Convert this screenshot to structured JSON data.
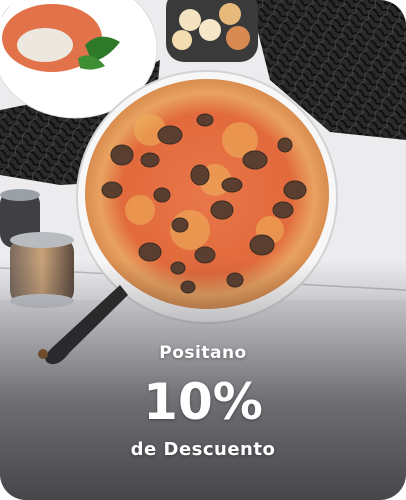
{
  "promo": {
    "restaurant": "Positano",
    "discount": "10%",
    "subtitle": "de Descuento",
    "image_icon": "pizza-photo"
  },
  "colors": {
    "card_background": "#f1f1f3",
    "text": "#ffffff",
    "table_top": "#ececef",
    "placemat": "#1c1c1c",
    "pizza_crust": "#e29a5a",
    "pizza_sauce": "#e0623a",
    "mushroom": "#5a3f30"
  }
}
